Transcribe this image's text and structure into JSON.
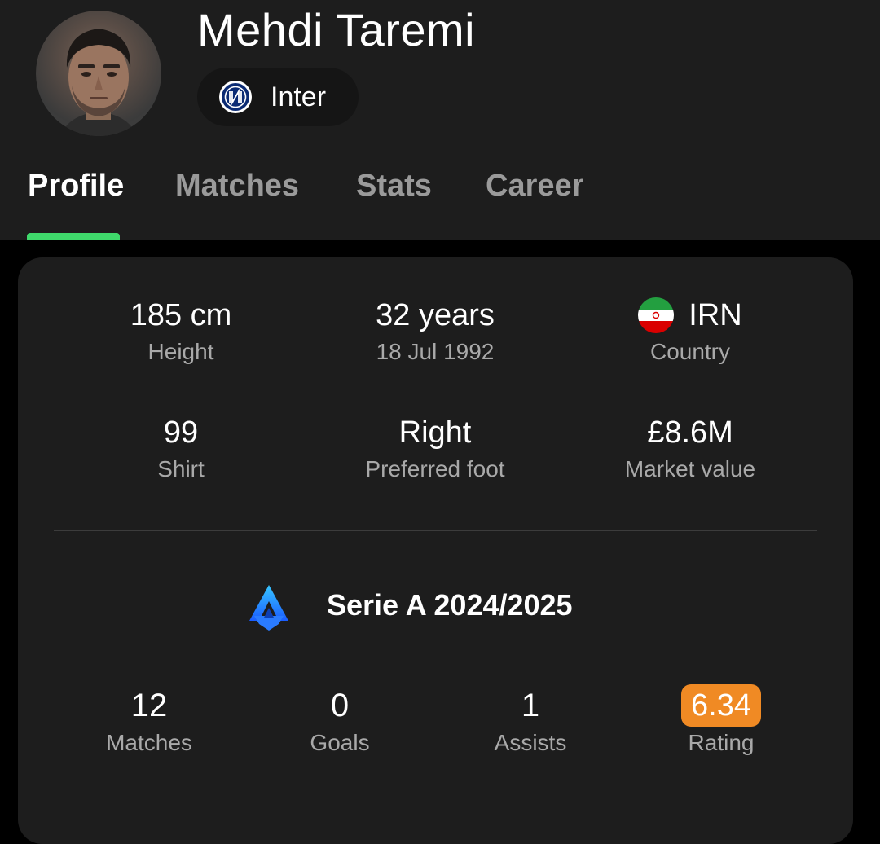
{
  "player": {
    "name": "Mehdi Taremi",
    "team": "Inter"
  },
  "tabs": [
    {
      "label": "Profile",
      "active": true
    },
    {
      "label": "Matches",
      "active": false
    },
    {
      "label": "Stats",
      "active": false
    },
    {
      "label": "Career",
      "active": false
    }
  ],
  "info": {
    "height": {
      "value": "185 cm",
      "label": "Height"
    },
    "age": {
      "value": "32 years",
      "label": "18 Jul 1992"
    },
    "country": {
      "value": "IRN",
      "label": "Country",
      "icon": "iran-flag-icon"
    },
    "shirt": {
      "value": "99",
      "label": "Shirt"
    },
    "foot": {
      "value": "Right",
      "label": "Preferred foot"
    },
    "market": {
      "value": "£8.6M",
      "label": "Market value"
    }
  },
  "league": {
    "name": "Serie A 2024/2025",
    "icon": "serie-a-logo-icon"
  },
  "season_stats": {
    "matches": {
      "value": "12",
      "label": "Matches"
    },
    "goals": {
      "value": "0",
      "label": "Goals"
    },
    "assists": {
      "value": "1",
      "label": "Assists"
    },
    "rating": {
      "value": "6.34",
      "label": "Rating"
    }
  },
  "colors": {
    "accent": "#3fd96b",
    "rating_badge": "#f08a24",
    "header_bg": "#1d1d1d",
    "card_bg": "#1d1d1d",
    "page_bg": "#000000"
  }
}
